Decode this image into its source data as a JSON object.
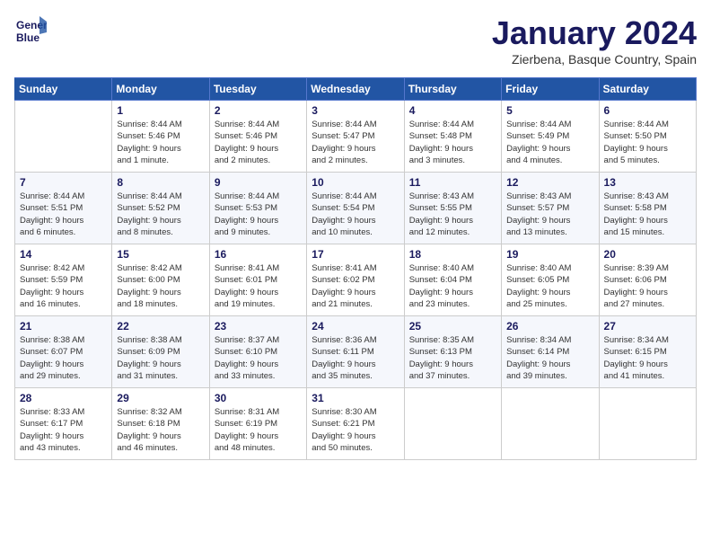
{
  "header": {
    "logo_line1": "General",
    "logo_line2": "Blue",
    "month": "January 2024",
    "location": "Zierbena, Basque Country, Spain"
  },
  "weekdays": [
    "Sunday",
    "Monday",
    "Tuesday",
    "Wednesday",
    "Thursday",
    "Friday",
    "Saturday"
  ],
  "weeks": [
    [
      {
        "day": "",
        "info": ""
      },
      {
        "day": "1",
        "info": "Sunrise: 8:44 AM\nSunset: 5:46 PM\nDaylight: 9 hours\nand 1 minute."
      },
      {
        "day": "2",
        "info": "Sunrise: 8:44 AM\nSunset: 5:46 PM\nDaylight: 9 hours\nand 2 minutes."
      },
      {
        "day": "3",
        "info": "Sunrise: 8:44 AM\nSunset: 5:47 PM\nDaylight: 9 hours\nand 2 minutes."
      },
      {
        "day": "4",
        "info": "Sunrise: 8:44 AM\nSunset: 5:48 PM\nDaylight: 9 hours\nand 3 minutes."
      },
      {
        "day": "5",
        "info": "Sunrise: 8:44 AM\nSunset: 5:49 PM\nDaylight: 9 hours\nand 4 minutes."
      },
      {
        "day": "6",
        "info": "Sunrise: 8:44 AM\nSunset: 5:50 PM\nDaylight: 9 hours\nand 5 minutes."
      }
    ],
    [
      {
        "day": "7",
        "info": "Sunrise: 8:44 AM\nSunset: 5:51 PM\nDaylight: 9 hours\nand 6 minutes."
      },
      {
        "day": "8",
        "info": "Sunrise: 8:44 AM\nSunset: 5:52 PM\nDaylight: 9 hours\nand 8 minutes."
      },
      {
        "day": "9",
        "info": "Sunrise: 8:44 AM\nSunset: 5:53 PM\nDaylight: 9 hours\nand 9 minutes."
      },
      {
        "day": "10",
        "info": "Sunrise: 8:44 AM\nSunset: 5:54 PM\nDaylight: 9 hours\nand 10 minutes."
      },
      {
        "day": "11",
        "info": "Sunrise: 8:43 AM\nSunset: 5:55 PM\nDaylight: 9 hours\nand 12 minutes."
      },
      {
        "day": "12",
        "info": "Sunrise: 8:43 AM\nSunset: 5:57 PM\nDaylight: 9 hours\nand 13 minutes."
      },
      {
        "day": "13",
        "info": "Sunrise: 8:43 AM\nSunset: 5:58 PM\nDaylight: 9 hours\nand 15 minutes."
      }
    ],
    [
      {
        "day": "14",
        "info": "Sunrise: 8:42 AM\nSunset: 5:59 PM\nDaylight: 9 hours\nand 16 minutes."
      },
      {
        "day": "15",
        "info": "Sunrise: 8:42 AM\nSunset: 6:00 PM\nDaylight: 9 hours\nand 18 minutes."
      },
      {
        "day": "16",
        "info": "Sunrise: 8:41 AM\nSunset: 6:01 PM\nDaylight: 9 hours\nand 19 minutes."
      },
      {
        "day": "17",
        "info": "Sunrise: 8:41 AM\nSunset: 6:02 PM\nDaylight: 9 hours\nand 21 minutes."
      },
      {
        "day": "18",
        "info": "Sunrise: 8:40 AM\nSunset: 6:04 PM\nDaylight: 9 hours\nand 23 minutes."
      },
      {
        "day": "19",
        "info": "Sunrise: 8:40 AM\nSunset: 6:05 PM\nDaylight: 9 hours\nand 25 minutes."
      },
      {
        "day": "20",
        "info": "Sunrise: 8:39 AM\nSunset: 6:06 PM\nDaylight: 9 hours\nand 27 minutes."
      }
    ],
    [
      {
        "day": "21",
        "info": "Sunrise: 8:38 AM\nSunset: 6:07 PM\nDaylight: 9 hours\nand 29 minutes."
      },
      {
        "day": "22",
        "info": "Sunrise: 8:38 AM\nSunset: 6:09 PM\nDaylight: 9 hours\nand 31 minutes."
      },
      {
        "day": "23",
        "info": "Sunrise: 8:37 AM\nSunset: 6:10 PM\nDaylight: 9 hours\nand 33 minutes."
      },
      {
        "day": "24",
        "info": "Sunrise: 8:36 AM\nSunset: 6:11 PM\nDaylight: 9 hours\nand 35 minutes."
      },
      {
        "day": "25",
        "info": "Sunrise: 8:35 AM\nSunset: 6:13 PM\nDaylight: 9 hours\nand 37 minutes."
      },
      {
        "day": "26",
        "info": "Sunrise: 8:34 AM\nSunset: 6:14 PM\nDaylight: 9 hours\nand 39 minutes."
      },
      {
        "day": "27",
        "info": "Sunrise: 8:34 AM\nSunset: 6:15 PM\nDaylight: 9 hours\nand 41 minutes."
      }
    ],
    [
      {
        "day": "28",
        "info": "Sunrise: 8:33 AM\nSunset: 6:17 PM\nDaylight: 9 hours\nand 43 minutes."
      },
      {
        "day": "29",
        "info": "Sunrise: 8:32 AM\nSunset: 6:18 PM\nDaylight: 9 hours\nand 46 minutes."
      },
      {
        "day": "30",
        "info": "Sunrise: 8:31 AM\nSunset: 6:19 PM\nDaylight: 9 hours\nand 48 minutes."
      },
      {
        "day": "31",
        "info": "Sunrise: 8:30 AM\nSunset: 6:21 PM\nDaylight: 9 hours\nand 50 minutes."
      },
      {
        "day": "",
        "info": ""
      },
      {
        "day": "",
        "info": ""
      },
      {
        "day": "",
        "info": ""
      }
    ]
  ]
}
